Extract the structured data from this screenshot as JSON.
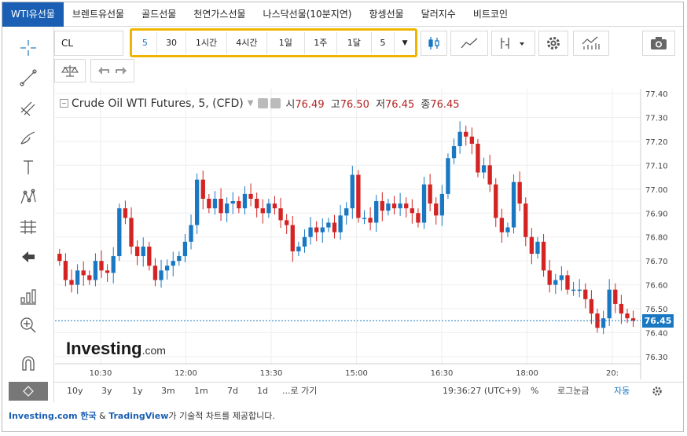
{
  "tabs": [
    {
      "label": "WTI유선물",
      "active": true
    },
    {
      "label": "브렌트유선물",
      "active": false
    },
    {
      "label": "골드선물",
      "active": false
    },
    {
      "label": "천연가스선물",
      "active": false
    },
    {
      "label": "나스닥선물(10분지연)",
      "active": false
    },
    {
      "label": "항셍선물",
      "active": false
    },
    {
      "label": "달러지수",
      "active": false
    },
    {
      "label": "비트코인",
      "active": false
    }
  ],
  "symbol": "CL",
  "intervals": [
    "5",
    "30",
    "1시간",
    "4시간",
    "1일",
    "1주",
    "1달",
    "5"
  ],
  "active_interval": "5",
  "legend": {
    "title": "Crude Oil WTI Futures, 5, (CFD)",
    "open_label": "시",
    "open": "76.49",
    "high_label": "고",
    "high": "76.50",
    "low_label": "저",
    "low": "76.45",
    "close_label": "종",
    "close": "76.45"
  },
  "logo": {
    "main": "Investing",
    "suffix": ".com"
  },
  "last_price": "76.45",
  "bottom": {
    "ranges": [
      "10y",
      "3y",
      "1y",
      "3m",
      "1m",
      "7d",
      "1d"
    ],
    "goto": "...로 가기",
    "time": "19:36:27 (UTC+9)",
    "percent": "%",
    "log": "로그눈금",
    "auto": "자동"
  },
  "footer": {
    "link1": "Investing.com 한국",
    "amp": " & ",
    "link2": "TradingView",
    "text": "가 기술적 차트를 제공합니다."
  },
  "colors": {
    "up": "#1a78c2",
    "down": "#d32323",
    "accent": "#1a5fb4",
    "highlight": "#f0b400"
  },
  "chart_data": {
    "type": "candlestick",
    "x_ticks": [
      "10:30",
      "12:00",
      "13:30",
      "15:00",
      "16:30",
      "18:00",
      "20:"
    ],
    "y_ticks": [
      "77.40",
      "77.30",
      "77.20",
      "77.10",
      "77.00",
      "76.90",
      "76.80",
      "76.70",
      "76.60",
      "76.50",
      "76.40",
      "76.30"
    ],
    "ylim": [
      76.27,
      77.42
    ],
    "last_price_line": 76.45,
    "close_values": [
      76.7,
      76.62,
      76.6,
      76.66,
      76.64,
      76.62,
      76.7,
      76.66,
      76.65,
      76.72,
      76.92,
      76.88,
      76.76,
      76.72,
      76.76,
      76.68,
      76.62,
      76.66,
      76.68,
      76.7,
      76.72,
      76.78,
      76.85,
      77.04,
      76.96,
      76.92,
      76.96,
      76.9,
      76.94,
      76.95,
      76.92,
      76.98,
      76.96,
      76.92,
      76.9,
      76.94,
      76.92,
      76.87,
      76.85,
      76.74,
      76.76,
      76.8,
      76.84,
      76.82,
      76.84,
      76.86,
      76.82,
      76.89,
      76.92,
      77.06,
      76.88,
      76.88,
      76.86,
      76.95,
      76.91,
      76.94,
      76.92,
      76.94,
      76.92,
      76.9,
      76.86,
      77.02,
      76.94,
      76.89,
      76.98,
      77.13,
      77.18,
      77.24,
      77.22,
      77.19,
      77.07,
      77.1,
      77.02,
      76.88,
      76.82,
      76.84,
      77.03,
      76.94,
      76.8,
      76.73,
      76.78,
      76.66,
      76.6,
      76.62,
      76.64,
      76.58,
      76.58,
      76.58,
      76.54,
      76.48,
      76.42,
      76.46,
      76.58,
      76.52,
      76.48,
      76.46,
      76.45
    ]
  }
}
